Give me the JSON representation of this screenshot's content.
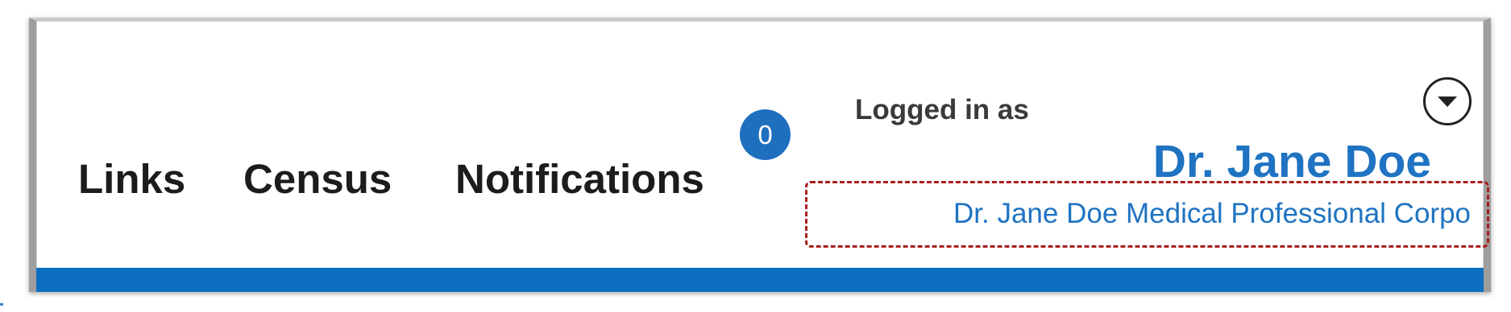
{
  "nav": {
    "links_label": "Links",
    "census_label": "Census",
    "notifications_label": "Notifications",
    "notifications_count": "0"
  },
  "user": {
    "logged_in_label": "Logged in as",
    "name": "Dr. Jane Doe",
    "organization": "Dr. Jane Doe Medical Professional Corpo",
    "menu_icon": "chevron-down-circle-icon"
  },
  "colors": {
    "accent_blue": "#1f73c2",
    "badge_blue": "#1f6fbf",
    "bar_blue": "#0d6fbf",
    "highlight_dashed_red": "#a8201a"
  }
}
